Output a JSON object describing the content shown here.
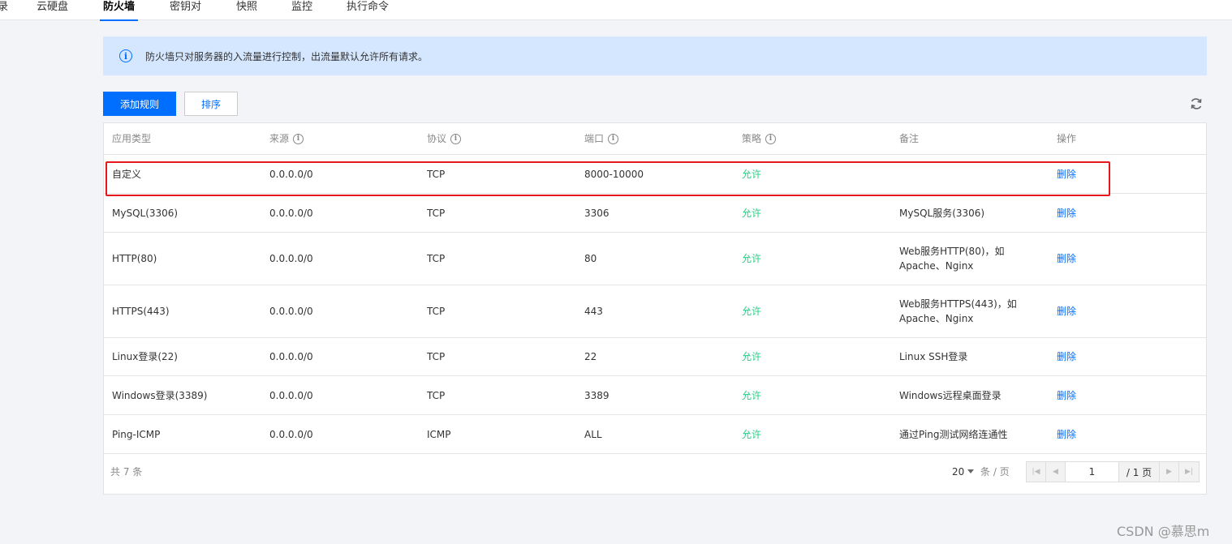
{
  "tabs": [
    {
      "label": "录",
      "active": false
    },
    {
      "label": "云硬盘",
      "active": false
    },
    {
      "label": "防火墙",
      "active": true
    },
    {
      "label": "密钥对",
      "active": false
    },
    {
      "label": "快照",
      "active": false
    },
    {
      "label": "监控",
      "active": false
    },
    {
      "label": "执行命令",
      "active": false
    }
  ],
  "notice": {
    "icon": "i",
    "text": "防火墙只对服务器的入流量进行控制，出流量默认允许所有请求。"
  },
  "toolbar": {
    "add_label": "添加规则",
    "sort_label": "排序"
  },
  "table": {
    "headers": [
      "应用类型",
      "来源",
      "协议",
      "端口",
      "策略",
      "备注",
      "操作"
    ],
    "help_icon": "i",
    "rows": [
      {
        "type": "自定义",
        "source": "0.0.0.0/0",
        "protocol": "TCP",
        "port": "8000-10000",
        "policy": "允许",
        "remark": "",
        "action": "删除"
      },
      {
        "type": "MySQL(3306)",
        "source": "0.0.0.0/0",
        "protocol": "TCP",
        "port": "3306",
        "policy": "允许",
        "remark": "MySQL服务(3306)",
        "action": "删除"
      },
      {
        "type": "HTTP(80)",
        "source": "0.0.0.0/0",
        "protocol": "TCP",
        "port": "80",
        "policy": "允许",
        "remark": "Web服务HTTP(80)，如 Apache、Nginx",
        "action": "删除"
      },
      {
        "type": "HTTPS(443)",
        "source": "0.0.0.0/0",
        "protocol": "TCP",
        "port": "443",
        "policy": "允许",
        "remark": "Web服务HTTPS(443)，如 Apache、Nginx",
        "action": "删除"
      },
      {
        "type": "Linux登录(22)",
        "source": "0.0.0.0/0",
        "protocol": "TCP",
        "port": "22",
        "policy": "允许",
        "remark": "Linux SSH登录",
        "action": "删除"
      },
      {
        "type": "Windows登录(3389)",
        "source": "0.0.0.0/0",
        "protocol": "TCP",
        "port": "3389",
        "policy": "允许",
        "remark": "Windows远程桌面登录",
        "action": "删除"
      },
      {
        "type": "Ping-ICMP",
        "source": "0.0.0.0/0",
        "protocol": "ICMP",
        "port": "ALL",
        "policy": "允许",
        "remark": "通过Ping测试网络连通性",
        "action": "删除"
      }
    ]
  },
  "footer": {
    "total": "共 7 条",
    "page_size": "20",
    "per_page": "条 / 页",
    "current_page": "1",
    "total_pages": "/ 1 页"
  },
  "watermark": "CSDN @慕思m",
  "colors": {
    "accent": "#006eff",
    "allow": "#29cc85",
    "highlight": "#e6161d",
    "notice_bg": "#d5e7ff"
  }
}
